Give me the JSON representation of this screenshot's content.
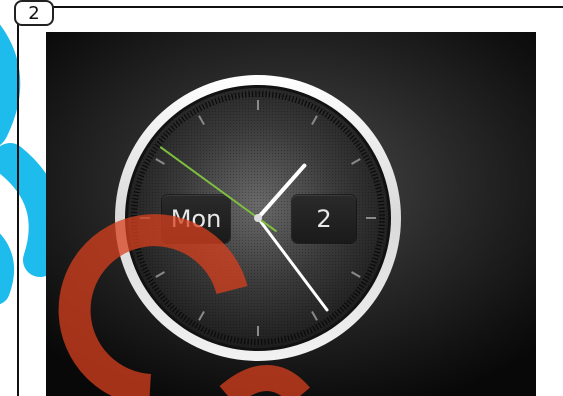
{
  "panel": {
    "badge": "2"
  },
  "clock": {
    "day_label": "Mon",
    "date_label": "2",
    "time": {
      "hours": 1,
      "minutes": 23,
      "seconds": 51
    },
    "colors": {
      "background": "#1a1a1a",
      "bezel": "#e6e6e6",
      "hands": "#ffffff",
      "second_hand": "#7fbf3f",
      "watermark_blue": "#12b7ec",
      "watermark_red": "#d8401e"
    },
    "icons": {
      "clock": "analog-clock-icon"
    }
  }
}
